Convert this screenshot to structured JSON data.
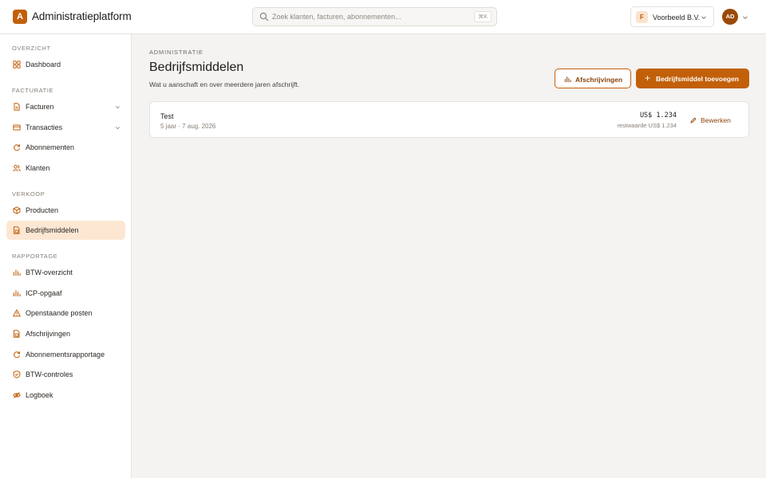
{
  "app": {
    "logo_letter": "A",
    "title": "Administratieplatform"
  },
  "search": {
    "placeholder": "Zoek klanten, facturen, abonnementen...",
    "shortcut": "⌘K"
  },
  "org": {
    "initial": "F",
    "name": "Voorbeeld B.V."
  },
  "user": {
    "initials": "AD"
  },
  "sidebar": {
    "sections": [
      {
        "label": "Overzicht",
        "items": [
          {
            "label": "Dashboard",
            "icon": "grid-icon"
          }
        ]
      },
      {
        "label": "Facturatie",
        "items": [
          {
            "label": "Facturen",
            "icon": "document-icon",
            "expandable": true
          },
          {
            "label": "Transacties",
            "icon": "card-icon",
            "expandable": true
          },
          {
            "label": "Abonnementen",
            "icon": "refresh-icon"
          },
          {
            "label": "Klanten",
            "icon": "users-icon"
          }
        ]
      },
      {
        "label": "Verkoop",
        "items": [
          {
            "label": "Producten",
            "icon": "box-icon"
          },
          {
            "label": "Bedrijfsmiddelen",
            "icon": "asset-icon",
            "active": true
          }
        ]
      },
      {
        "label": "Rapportage",
        "items": [
          {
            "label": "BTW-overzicht",
            "icon": "bar-chart-icon"
          },
          {
            "label": "ICP-opgaaf",
            "icon": "bar-chart-icon"
          },
          {
            "label": "Openstaande posten",
            "icon": "warning-icon"
          },
          {
            "label": "Afschrijvingen",
            "icon": "asset-icon"
          },
          {
            "label": "Abonnementsrapportage",
            "icon": "refresh-icon"
          },
          {
            "label": "BTW-controles",
            "icon": "shield-check-icon"
          },
          {
            "label": "Logboek",
            "icon": "eye-off-icon"
          }
        ]
      }
    ]
  },
  "main": {
    "eyebrow": "Administratie",
    "title": "Bedrijfsmiddelen",
    "subtitle": "Wat u aanschaft en over meerdere jaren afschrijft.",
    "secondary_button": "Afschrijvingen",
    "primary_button": "Bedrijfsmiddel toevoegen",
    "assets": [
      {
        "name": "Test",
        "meta": "5 jaar · 7 aug. 2026",
        "value": "US$ 1.234",
        "residual": "restwaarde US$ 1.234",
        "edit_label": "Bewerken"
      }
    ]
  },
  "colors": {
    "accent": "#c2600a",
    "accent_dark": "#8a430a",
    "active_bg": "#fde7d3",
    "page_bg": "#f4f3f1"
  }
}
